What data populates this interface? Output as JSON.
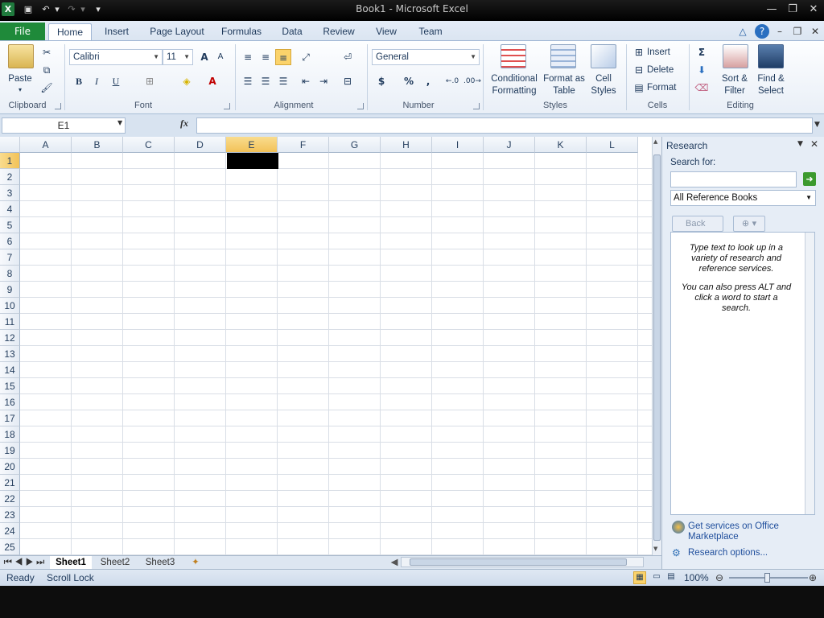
{
  "window": {
    "title": "Book1 - Microsoft Excel"
  },
  "tabs": [
    "File",
    "Home",
    "Insert",
    "Page Layout",
    "Formulas",
    "Data",
    "Review",
    "View",
    "Team"
  ],
  "active_tab": "Home",
  "ribbon": {
    "clipboard": {
      "label": "Clipboard",
      "paste": "Paste"
    },
    "font": {
      "label": "Font",
      "name": "Calibri",
      "size": "11",
      "bold": "B",
      "italic": "I",
      "underline": "U",
      "grow": "A",
      "shrink": "A"
    },
    "alignment": {
      "label": "Alignment"
    },
    "number": {
      "label": "Number",
      "format": "General",
      "currency": "$",
      "percent": "%",
      "comma": ","
    },
    "styles": {
      "label": "Styles",
      "conditional_1": "Conditional",
      "conditional_2": "Formatting",
      "format_table_1": "Format as",
      "format_table_2": "Table",
      "cell_styles_1": "Cell",
      "cell_styles_2": "Styles"
    },
    "cells": {
      "label": "Cells",
      "insert": "Insert",
      "delete": "Delete",
      "format": "Format"
    },
    "editing": {
      "label": "Editing",
      "sort_1": "Sort &",
      "sort_2": "Filter",
      "find_1": "Find &",
      "find_2": "Select",
      "sigma": "Σ"
    }
  },
  "formula_bar": {
    "name_box": "E1",
    "fx": "fx",
    "value": ""
  },
  "columns": [
    "A",
    "B",
    "C",
    "D",
    "E",
    "F",
    "G",
    "H",
    "I",
    "J",
    "K",
    "L"
  ],
  "rows": [
    "1",
    "2",
    "3",
    "4",
    "5",
    "6",
    "7",
    "8",
    "9",
    "10",
    "11",
    "12",
    "13",
    "14",
    "15",
    "16",
    "17",
    "18",
    "19",
    "20",
    "21",
    "22",
    "23",
    "24",
    "25"
  ],
  "sheets": [
    "Sheet1",
    "Sheet2",
    "Sheet3"
  ],
  "active_sheet": "Sheet1",
  "status": {
    "ready": "Ready",
    "scroll_lock": "Scroll Lock",
    "zoom": "100%"
  },
  "research": {
    "title": "Research",
    "search_label": "Search for:",
    "search_value": "",
    "source": "All Reference Books",
    "back": "Back",
    "hint1": "Type text to look up in a variety of research and reference services.",
    "hint2": "You can also press ALT and click a word to start a search.",
    "get_services_1": "Get services on Office",
    "get_services_2": "Marketplace",
    "options": "Research options..."
  },
  "colors": {
    "file_tab": "#1f8a3a",
    "selected_cell": "#000000",
    "ribbon_bg": "#e9eff7"
  }
}
